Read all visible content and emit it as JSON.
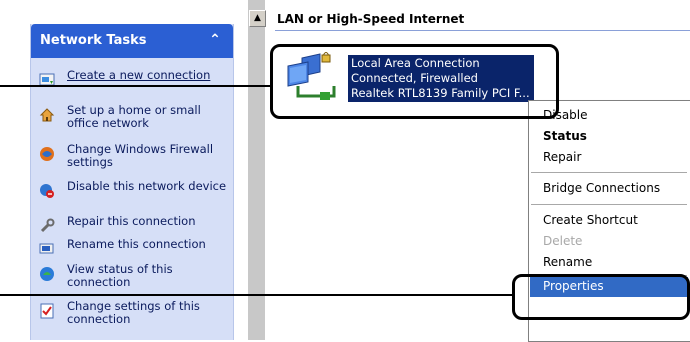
{
  "task_pane": {
    "title": "Network Tasks",
    "collapse_glyph": "⌃",
    "items": [
      {
        "icon": "new-connection-icon",
        "label": "Create a new connection"
      },
      {
        "icon": "home-network-icon",
        "label": "Set up a home or small office network"
      },
      {
        "icon": "firewall-icon",
        "label": "Change Windows Firewall settings"
      },
      {
        "icon": "disable-device-icon",
        "label": "Disable this network device"
      },
      {
        "icon": "repair-icon",
        "label": "Repair this connection"
      },
      {
        "icon": "rename-icon",
        "label": "Rename this connection"
      },
      {
        "icon": "status-icon",
        "label": "View status of this connection"
      },
      {
        "icon": "settings-icon",
        "label": "Change settings of this connection"
      }
    ]
  },
  "content": {
    "group_title": "LAN or High-Speed Internet",
    "connection": {
      "name": "Local Area Connection",
      "status": "Connected, Firewalled",
      "device": "Realtek RTL8139 Family PCI F..."
    }
  },
  "context_menu": {
    "items": [
      "Disable",
      "Status",
      "Repair",
      "Bridge Connections",
      "Create Shortcut",
      "Delete",
      "Rename",
      "Properties"
    ],
    "default_item": "Status",
    "disabled_item": "Delete",
    "selected_item": "Properties"
  },
  "colors": {
    "task_header": "#2b5fd3",
    "task_body": "#d6dff7",
    "selection": "#0a246a",
    "menu_highlight": "#316ac5"
  }
}
